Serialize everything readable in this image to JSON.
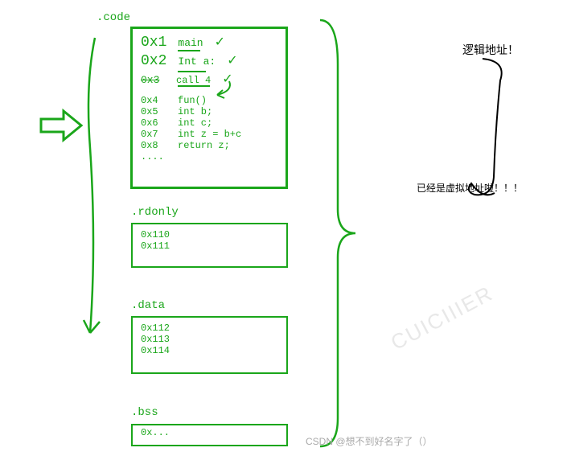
{
  "sections": {
    "code": {
      "label": ".code",
      "rows": [
        {
          "addr": "0x1",
          "instr": "main",
          "check": "✓",
          "big": true
        },
        {
          "addr": "0x2",
          "instr": "Int a:",
          "check": "✓",
          "big": true
        },
        {
          "addr": "0x3",
          "instr": "call 4",
          "check": "✓",
          "big": false,
          "strike": true
        },
        {
          "addr": "0x4",
          "instr": "fun()",
          "big": false
        },
        {
          "addr": "0x5",
          "instr": "int b;",
          "big": false
        },
        {
          "addr": "0x6",
          "instr": "int c;",
          "big": false
        },
        {
          "addr": "0x7",
          "instr": "int z = b+c",
          "big": false
        },
        {
          "addr": "0x8",
          "instr": "return z;",
          "big": false
        },
        {
          "addr": "....",
          "instr": "",
          "big": false
        }
      ]
    },
    "rdonly": {
      "label": ".rdonly",
      "rows": [
        "0x110",
        "0x111"
      ]
    },
    "data": {
      "label": ".data",
      "rows": [
        "0x112",
        "0x113",
        "0x114"
      ]
    },
    "bss": {
      "label": ".bss",
      "rows": [
        "0x..."
      ]
    }
  },
  "annotations": {
    "top": "逻辑地址！",
    "mid": "已经是虚拟地址啦！！！"
  },
  "watermark": "CSDN @想不到好名字了（）"
}
